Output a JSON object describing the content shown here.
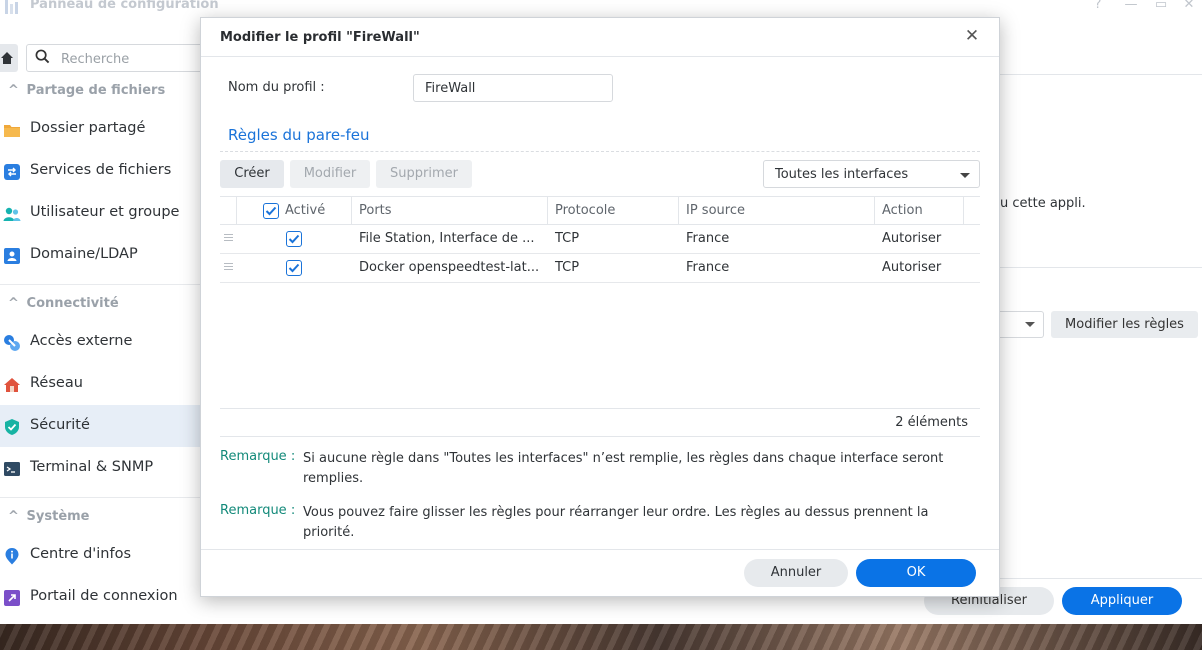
{
  "window": {
    "title": "Panneau de configuration",
    "help_glyph": "?",
    "minimize_glyph": "—",
    "maximize_glyph": "▭",
    "close_glyph": "✕"
  },
  "search": {
    "placeholder": "Recherche"
  },
  "sidebar": {
    "sections": [
      {
        "label": "Partage de fichiers"
      },
      {
        "label": "Connectivité"
      },
      {
        "label": "Système"
      }
    ],
    "items": [
      {
        "label": "Dossier partagé",
        "icon": "folder-icon"
      },
      {
        "label": "Services de fichiers",
        "icon": "file-services-icon"
      },
      {
        "label": "Utilisateur et groupe",
        "icon": "users-icon"
      },
      {
        "label": "Domaine/LDAP",
        "icon": "domain-icon"
      },
      {
        "label": "Accès externe",
        "icon": "external-access-icon"
      },
      {
        "label": "Réseau",
        "icon": "network-home-icon"
      },
      {
        "label": "Sécurité",
        "icon": "shield-icon",
        "active": true
      },
      {
        "label": "Terminal & SNMP",
        "icon": "terminal-icon"
      },
      {
        "label": "Centre d'infos",
        "icon": "info-pin-icon"
      },
      {
        "label": "Portail de connexion",
        "icon": "login-portal-icon"
      }
    ]
  },
  "background": {
    "partial_text": "u cette appli.",
    "modify_rules_label": "Modifier les règles",
    "reset_label": "Réinitialiser",
    "apply_label": "Appliquer"
  },
  "modal": {
    "title": "Modifier le profil \"FireWall\"",
    "profile_label": "Nom du profil :",
    "profile_value": "FireWall",
    "section_title": "Règles du pare-feu",
    "toolbar": {
      "create": "Créer",
      "modify": "Modifier",
      "delete": "Supprimer"
    },
    "interface_select": "Toutes les interfaces",
    "table": {
      "headers": {
        "active": "Activé",
        "ports": "Ports",
        "protocol": "Protocole",
        "source_ip": "IP source",
        "action": "Action"
      },
      "rows": [
        {
          "active": true,
          "ports": "File Station, Interface de ...",
          "protocol": "TCP",
          "source_ip": "France",
          "action": "Autoriser"
        },
        {
          "active": true,
          "ports": "Docker openspeedtest-lat...",
          "protocol": "TCP",
          "source_ip": "France",
          "action": "Autoriser"
        }
      ]
    },
    "count": "2 éléments",
    "notes": [
      {
        "tag": "Remarque :",
        "text": "Si aucune règle dans \"Toutes les interfaces\" n’est remplie, les règles dans chaque interface seront remplies."
      },
      {
        "tag": "Remarque :",
        "text": "Vous pouvez faire glisser les règles pour réarranger leur ordre. Les règles au dessus prennent la priorité."
      }
    ],
    "cancel": "Annuler",
    "ok": "OK"
  },
  "colors": {
    "accent": "#0a73e6",
    "link_blue": "#1a73d9",
    "note_teal": "#138a7a",
    "sidebar_active": "#e7eef7"
  }
}
